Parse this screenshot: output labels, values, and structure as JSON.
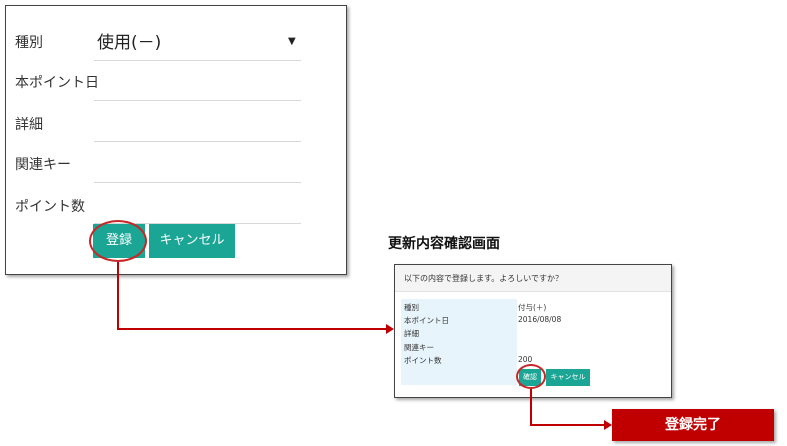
{
  "form": {
    "type_label": "種別",
    "type_value": "使用(－)",
    "caret": "▼",
    "date_label": "本ポイント日",
    "detail_label": "詳細",
    "key_label": "関連キー",
    "points_label": "ポイント数",
    "register_button": "登録",
    "cancel_button": "キャンセル"
  },
  "confirm": {
    "heading": "更新内容確認画面",
    "message": "以下の内容で登録します。よろしいですか？",
    "rows": [
      {
        "label": "種別",
        "value": "付与(＋)"
      },
      {
        "label": "本ポイント日",
        "value": "2016/08/08"
      },
      {
        "label": "詳細",
        "value": ""
      },
      {
        "label": "関連キー",
        "value": ""
      },
      {
        "label": "ポイント数",
        "value": "200"
      }
    ],
    "confirm_button": "確認",
    "cancel_button": "キャンセル"
  },
  "complete": {
    "label": "登録完了"
  },
  "colors": {
    "accent": "#1aa595",
    "highlight": "#c00000",
    "label_bg": "#e7f4fb"
  }
}
